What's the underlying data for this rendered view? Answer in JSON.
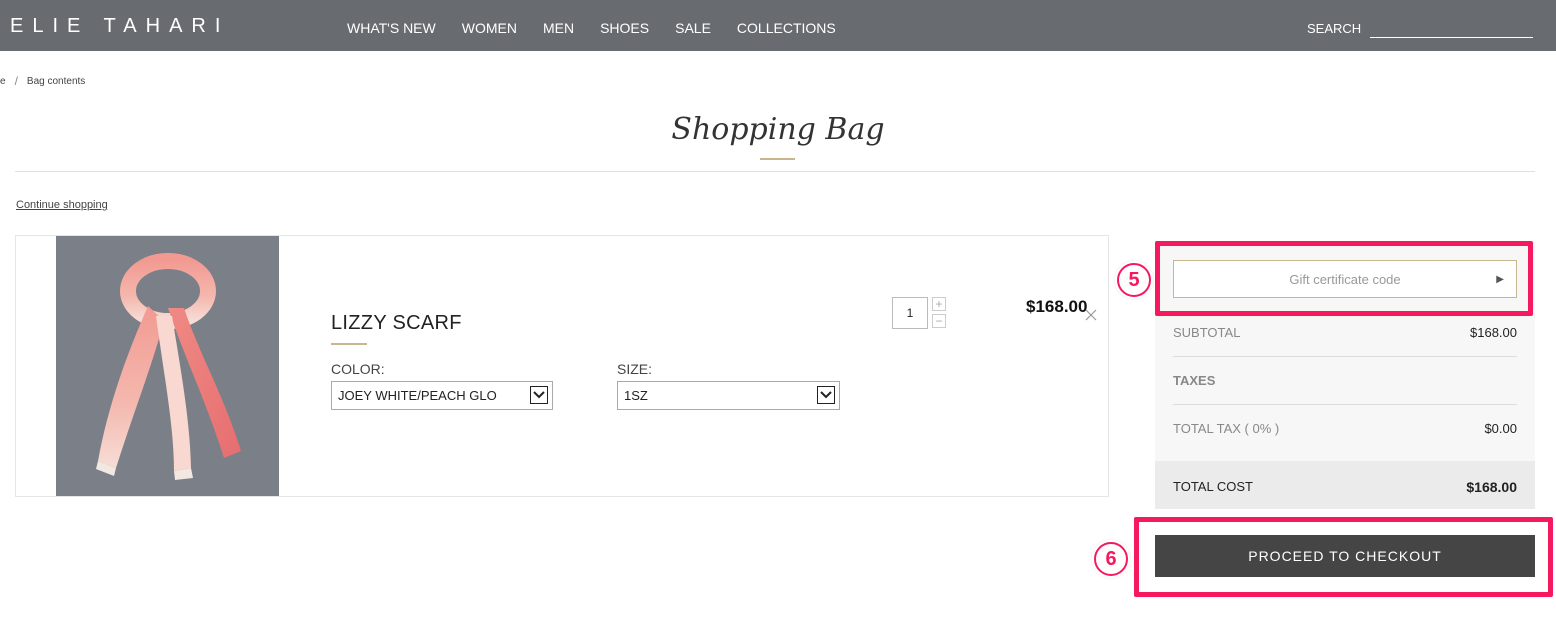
{
  "header": {
    "logo": "ELIE TAHARI",
    "nav": [
      "WHAT'S NEW",
      "WOMEN",
      "MEN",
      "SHOES",
      "SALE",
      "COLLECTIONS"
    ],
    "search_label": "SEARCH",
    "search_value": ""
  },
  "breadcrumb": {
    "home_fragment": "e",
    "separator": "/",
    "current": "Bag contents"
  },
  "page": {
    "title": "Shopping Bag",
    "continue_label": "Continue shopping"
  },
  "item": {
    "name": "LIZZY SCARF",
    "color_label": "COLOR:",
    "color_value": "JOEY WHITE/PEACH GLO",
    "size_label": "SIZE:",
    "size_value": "1SZ",
    "quantity": "1",
    "qty_plus": "+",
    "qty_minus": "−",
    "price": "$168.00"
  },
  "summary": {
    "gift_placeholder": "Gift certificate code",
    "subtotal_label": "SUBTOTAL",
    "subtotal_value": "$168.00",
    "taxes_label": "TAXES",
    "total_tax_label": "TOTAL TAX ( 0% )",
    "total_tax_value": "$0.00",
    "total_cost_label": "TOTAL COST",
    "total_cost_value": "$168.00",
    "checkout_label": "PROCEED TO CHECKOUT"
  },
  "annotations": {
    "step5": "5",
    "step6": "6",
    "highlight_color": "#f5195f"
  },
  "colors": {
    "header_bg": "#686c70",
    "accent_gold": "#c8b78e",
    "checkout_bg": "#454545"
  },
  "icons": {
    "remove": "close-icon",
    "gift_submit": "play-arrow-icon",
    "select_arrow": "chevron-down-icon"
  }
}
